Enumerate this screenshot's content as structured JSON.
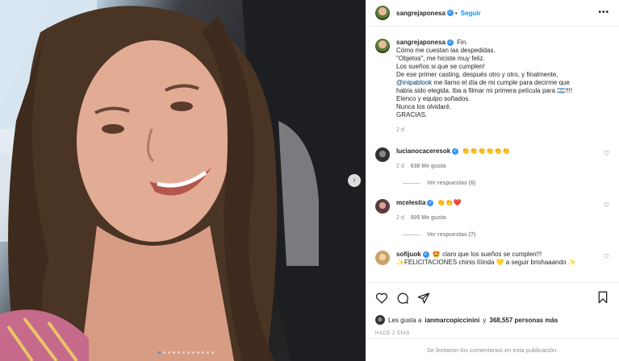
{
  "post": {
    "username": "sangrejaponesa",
    "follow_label": "Seguir",
    "more_label": "•••",
    "caption_lines": [
      "Fin.",
      "Cómo me cuestan las despedidas.",
      "\"Objetos\", me hiciste muy feliz.",
      "Los sueños si que se cumplen!",
      "De ese primer casting, después otro y otro, y finalmente,",
      "me llamo el día de mi cumple para decirme que",
      "había sido elegida. Iba a filmar mi primera película para 🇦🇷!!!!",
      "Elenco y equipo soñados.",
      "Nunca los olvidaré.",
      "GRACIAS."
    ],
    "caption_mention": "@inipablook",
    "caption_time": "2 d"
  },
  "comments": [
    {
      "username": "lucianocaceresok",
      "text": "👏👏👏👏👏👏",
      "time": "2 d",
      "likes": "638 Me gusta",
      "replies": "Ver respuestas (6)"
    },
    {
      "username": "mcelestia",
      "text": "👏👏❤️",
      "time": "2 d",
      "likes": "505 Me gusta",
      "replies": "Ver respuestas (7)"
    },
    {
      "username": "sofijuok",
      "text": "🤩 claro que los sueños se cumplen!!!",
      "text2": "✨FELICITACIONES chinis lííinda 💛 a seguir brishaaando ✨"
    }
  ],
  "actions": {
    "likes_prefix": "Les gusta a",
    "likes_user": "ianmarcopiccinini",
    "likes_connector": "y",
    "likes_count": "368,557 personas más",
    "ago": "HACE 2 DÍAS",
    "comments_closed": "Se limitaron los comentarios en esta publicación."
  },
  "carousel": {
    "slide_count": 12,
    "active_index": 0
  },
  "icons": [
    "next-arrow-icon",
    "heart-icon",
    "comment-icon",
    "share-icon",
    "bookmark-icon",
    "verified-icon",
    "more-icon"
  ],
  "colors": {
    "accent": "#0095f6",
    "verified": "#3897f0",
    "muted": "#8e8e8e",
    "text": "#262626"
  }
}
